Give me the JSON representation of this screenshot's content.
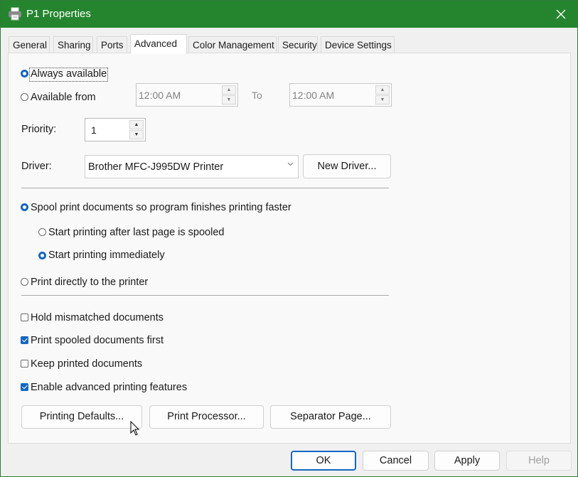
{
  "window": {
    "title": "P1 Properties",
    "accent_color": "#24852e",
    "icons": {
      "app": "printer-icon",
      "close": "close-icon"
    }
  },
  "tabs": [
    {
      "label": "General",
      "active": false
    },
    {
      "label": "Sharing",
      "active": false
    },
    {
      "label": "Ports",
      "active": false
    },
    {
      "label": "Advanced",
      "active": true
    },
    {
      "label": "Color Management",
      "active": false
    },
    {
      "label": "Security",
      "active": false
    },
    {
      "label": "Device Settings",
      "active": false
    }
  ],
  "availability": {
    "always_label": "Always available",
    "always_checked": true,
    "from_label": "Available from",
    "from_checked": false,
    "from_time": "12:00 AM",
    "to_label": "To",
    "to_time": "12:00 AM"
  },
  "priority": {
    "label": "Priority:",
    "value": "1"
  },
  "driver": {
    "label": "Driver:",
    "value": "Brother MFC-J995DW Printer",
    "new_driver_button": "New Driver..."
  },
  "spool": {
    "spool_label": "Spool print documents so program finishes printing faster",
    "spool_checked": true,
    "after_last_label": "Start printing after last page is spooled",
    "after_last_checked": false,
    "immediately_label": "Start printing immediately",
    "immediately_checked": true,
    "direct_label": "Print directly to the printer",
    "direct_checked": false
  },
  "options": [
    {
      "label": "Hold mismatched documents",
      "checked": false
    },
    {
      "label": "Print spooled documents first",
      "checked": true
    },
    {
      "label": "Keep printed documents",
      "checked": false
    },
    {
      "label": "Enable advanced printing features",
      "checked": true
    }
  ],
  "bottom_buttons": {
    "printing_defaults": "Printing Defaults...",
    "print_processor": "Print Processor...",
    "separator_page": "Separator Page..."
  },
  "dialog_buttons": {
    "ok": "OK",
    "cancel": "Cancel",
    "apply": "Apply",
    "help": "Help"
  }
}
